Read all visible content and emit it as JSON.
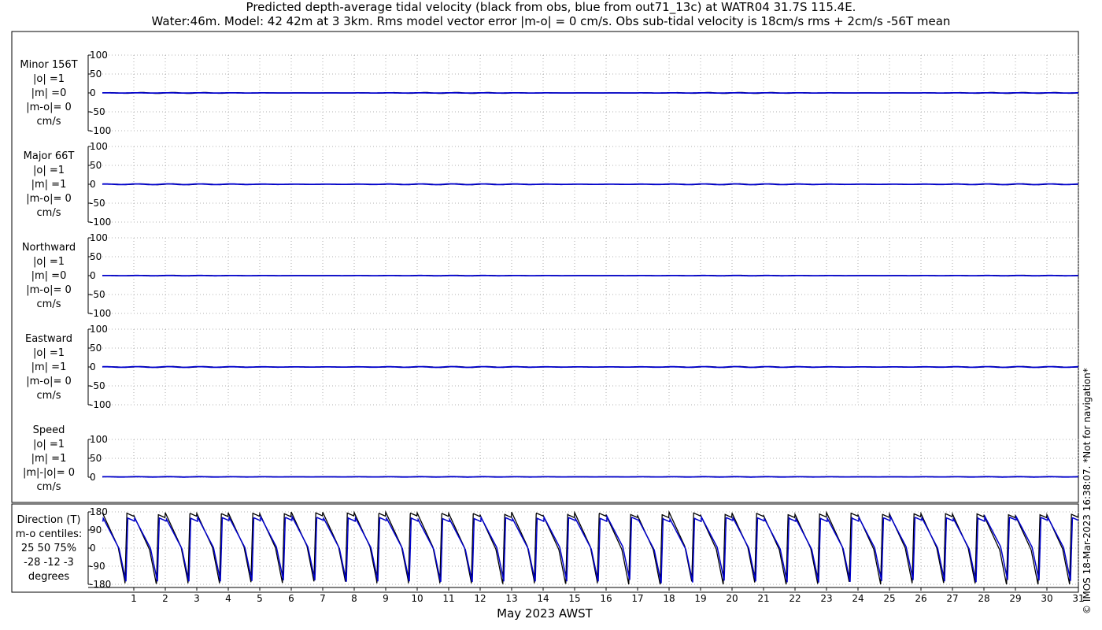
{
  "title": {
    "line1": "Predicted depth-average tidal velocity (black from obs, blue from out71_13c) at WATR04 31.7S 115.4E.",
    "line2": "Water:46m. Model: 42 42m at 3 3km. Rms model vector error |m-o| = 0 cm/s. Obs sub-tidal velocity is 18cm/s rms + 2cm/s -56T mean"
  },
  "credit": "© IMOS 18-Mar-2023 16:38:07. *Not for navigation*",
  "xlabel": "May 2023 AWST",
  "colors": {
    "obs": "#000000",
    "model": "#0000cc",
    "grid": "#999999"
  },
  "chart_data": [
    {
      "type": "line",
      "id": "minor",
      "label_lines": [
        "Minor 156T",
        "|o| =1",
        "|m| =0",
        "|m-o|= 0",
        "cm/s"
      ],
      "ylim": [
        -100,
        100
      ],
      "yticks": [
        100,
        50,
        0,
        -50,
        -100
      ],
      "xlim": [
        0,
        31
      ],
      "grid": true,
      "series": [
        {
          "mean": 0,
          "amp": 1.4
        },
        {
          "mean": 0,
          "amp": 0.3
        }
      ]
    },
    {
      "type": "line",
      "id": "major",
      "label_lines": [
        "Major 66T",
        "|o| =1",
        "|m| =1",
        "|m-o|= 0",
        "cm/s"
      ],
      "ylim": [
        -100,
        100
      ],
      "yticks": [
        100,
        50,
        0,
        -50,
        -100
      ],
      "xlim": [
        0,
        31
      ],
      "grid": true,
      "series": [
        {
          "mean": 0,
          "amp": 1.2
        },
        {
          "mean": 0,
          "amp": 1.0
        }
      ]
    },
    {
      "type": "line",
      "id": "northward",
      "label_lines": [
        "Northward",
        "|o| =1",
        "|m| =0",
        "|m-o|= 0",
        "cm/s"
      ],
      "ylim": [
        -100,
        100
      ],
      "yticks": [
        100,
        50,
        0,
        -50,
        -100
      ],
      "xlim": [
        0,
        31
      ],
      "grid": true,
      "series": [
        {
          "mean": 0,
          "amp": 1.0
        },
        {
          "mean": 0,
          "amp": 0.4
        }
      ]
    },
    {
      "type": "line",
      "id": "eastward",
      "label_lines": [
        "Eastward",
        "|o| =1",
        "|m| =1",
        "|m-o|= 0",
        "cm/s"
      ],
      "ylim": [
        -100,
        100
      ],
      "yticks": [
        100,
        50,
        0,
        -50,
        -100
      ],
      "xlim": [
        0,
        31
      ],
      "grid": true,
      "series": [
        {
          "mean": 0,
          "amp": 1.2
        },
        {
          "mean": 0,
          "amp": 1.0
        }
      ]
    },
    {
      "type": "line",
      "id": "speed",
      "label_lines": [
        "Speed",
        "|o| =1",
        "|m| =1",
        "|m|-|o|= 0",
        "cm/s"
      ],
      "ylim": [
        0,
        100
      ],
      "yticks": [
        100,
        50,
        0
      ],
      "xlim": [
        0,
        31
      ],
      "grid": true,
      "series": [
        {
          "mean": 1,
          "amp": 0.6
        },
        {
          "mean": 1,
          "amp": 0.5
        }
      ]
    },
    {
      "type": "line",
      "id": "direction",
      "label_lines": [
        "Direction (T)",
        "m-o centiles:",
        "25  50  75%",
        "-28 -12  -3",
        "degrees"
      ],
      "ylim": [
        -180,
        180
      ],
      "yticks": [
        180,
        90,
        0,
        -90,
        -180
      ],
      "xlim": [
        0,
        31
      ],
      "grid": true,
      "xticks": [
        1,
        2,
        3,
        4,
        5,
        6,
        7,
        8,
        9,
        10,
        11,
        12,
        13,
        14,
        15,
        16,
        17,
        18,
        19,
        20,
        21,
        22,
        23,
        24,
        25,
        26,
        27,
        28,
        29,
        30,
        31
      ],
      "period_days": 1.0,
      "series": [
        {
          "phase": 0.0,
          "peak": 170,
          "trough": -175
        },
        {
          "phase": 0.03,
          "peak": 150,
          "trough": -165
        }
      ]
    }
  ]
}
